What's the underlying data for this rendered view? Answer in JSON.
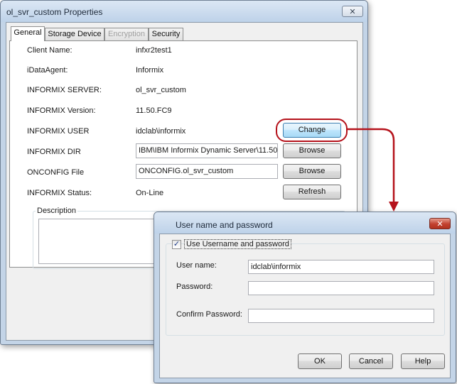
{
  "main_window": {
    "title": "ol_svr_custom Properties",
    "close_glyph": "✕",
    "tabs": [
      {
        "label": "General",
        "active": true
      },
      {
        "label": "Storage Device"
      },
      {
        "label": "Encryption",
        "disabled": true
      },
      {
        "label": "Security"
      }
    ],
    "fields": {
      "client_name_label": "Client Name:",
      "client_name_value": "infxr2test1",
      "idataagent_label": "iDataAgent:",
      "idataagent_value": "Informix",
      "server_label": "INFORMIX SERVER:",
      "server_value": "ol_svr_custom",
      "version_label": "INFORMIX Version:",
      "version_value": "11.50.FC9",
      "user_label": "INFORMIX USER",
      "user_value": "idclab\\informix",
      "dir_label": "INFORMIX DIR",
      "dir_value": "IBM\\IBM Informix Dynamic Server\\11.50",
      "onconfig_label": "ONCONFIG File",
      "onconfig_value": "ONCONFIG.ol_svr_custom",
      "status_label": "INFORMIX Status:",
      "status_value": "On-Line"
    },
    "buttons": {
      "change": "Change",
      "browse_dir": "Browse",
      "browse_onconfig": "Browse",
      "refresh": "Refresh"
    },
    "description_label": "Description",
    "description_value": ""
  },
  "dialog": {
    "title": "User name and password",
    "close_glyph": "✕",
    "use_credentials_label": "Use Username and password",
    "use_credentials_checked": true,
    "check_glyph": "✓",
    "username_label": "User name:",
    "username_value": "idclab\\informix",
    "password_label": "Password:",
    "password_value": "",
    "confirm_label": "Confirm Password:",
    "confirm_value": "",
    "ok": "OK",
    "cancel": "Cancel",
    "help": "Help"
  },
  "colors": {
    "callout": "#b5121b",
    "window_frame": "#c3d4e7",
    "dialog_close": "#c2412e"
  }
}
